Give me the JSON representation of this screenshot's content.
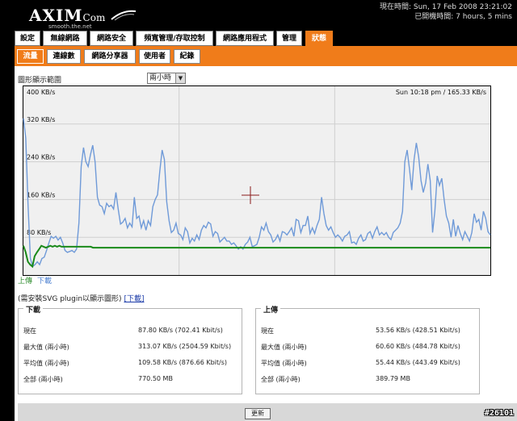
{
  "logo": {
    "brand": "AXIM",
    "brand_suffix": "Com",
    "tagline": "smooth.the.net"
  },
  "system": {
    "time_line": "現在時間: Sun, 17 Feb 2008 23:21:02",
    "uptime_line": "已開機時間: 7 hours, 5 mins"
  },
  "main_tabs": [
    {
      "label": "設定",
      "active": false
    },
    {
      "label": "無線網路",
      "active": false
    },
    {
      "label": "網路安全",
      "active": false
    },
    {
      "label": "頻寬管理/存取控制",
      "active": false
    },
    {
      "label": "網路應用程式",
      "active": false
    },
    {
      "label": "管理",
      "active": false
    },
    {
      "label": "狀態",
      "active": true
    }
  ],
  "sub_tabs": [
    {
      "label": "流量",
      "active": true
    },
    {
      "label": "連線數",
      "active": false
    },
    {
      "label": "網路分享器",
      "active": false
    },
    {
      "label": "使用者",
      "active": false
    },
    {
      "label": "紀錄",
      "active": false
    }
  ],
  "display_label": "圖形顯示範圍",
  "range_select": {
    "value": "兩小時"
  },
  "chart_data": {
    "type": "line",
    "info": "Sun 10:18 pm / 165.33 KB/s",
    "y_ticks": [
      "400 KB/s",
      "320 KB/s",
      "240 KB/s",
      "160 KB/s",
      "80 KB/s"
    ],
    "ylim": [
      0,
      400
    ],
    "grid": true,
    "series": [
      {
        "name": "下載",
        "color": "#6f9ad8",
        "values": [
          332,
          290,
          150,
          35,
          18,
          22,
          28,
          22,
          35,
          38,
          52,
          68,
          82,
          78,
          82,
          74,
          80,
          68,
          52,
          48,
          50,
          52,
          48,
          55,
          110,
          230,
          270,
          240,
          230,
          255,
          275,
          240,
          165,
          148,
          145,
          130,
          152,
          145,
          148,
          140,
          175,
          140,
          108,
          112,
          120,
          100,
          110,
          102,
          165,
          120,
          125,
          100,
          115,
          95,
          115,
          105,
          145,
          160,
          170,
          220,
          265,
          245,
          155,
          115,
          90,
          95,
          110,
          88,
          85,
          75,
          100,
          92,
          68,
          78,
          72,
          85,
          75,
          95,
          105,
          100,
          112,
          108,
          82,
          92,
          88,
          70,
          75,
          80,
          72,
          72,
          65,
          68,
          62,
          55,
          60,
          55,
          65,
          70,
          80,
          60,
          62,
          65,
          80,
          102,
          95,
          110,
          92,
          85,
          70,
          75,
          85,
          72,
          92,
          90,
          85,
          92,
          100,
          82,
          118,
          115,
          90,
          105,
          105,
          125,
          88,
          100,
          88,
          105,
          118,
          165,
          130,
          105,
          95,
          102,
          90,
          80,
          85,
          80,
          72,
          82,
          85,
          92,
          68,
          70,
          65,
          78,
          85,
          72,
          75,
          88,
          92,
          78,
          92,
          102,
          85,
          90,
          85,
          90,
          80,
          75,
          90,
          95,
          100,
          110,
          135,
          240,
          265,
          225,
          180,
          245,
          280,
          250,
          200,
          175,
          195,
          235,
          200,
          90,
          135,
          210,
          190,
          205,
          160,
          125,
          110,
          80,
          118,
          82,
          105,
          88,
          75,
          92,
          82,
          72,
          90,
          130,
          112,
          118,
          95,
          135,
          120,
          92,
          85
        ]
      },
      {
        "name": "上傳",
        "color": "#1a8a1a",
        "values": [
          62,
          48,
          28,
          22,
          18,
          40,
          48,
          55,
          62,
          60,
          58,
          60,
          62,
          60,
          62,
          60,
          62,
          60,
          60,
          60,
          60,
          60,
          60,
          60,
          60,
          60,
          60,
          60,
          60,
          60,
          60,
          58,
          58,
          58,
          58,
          58,
          58,
          58,
          58,
          58,
          58,
          58,
          58,
          58,
          58,
          58,
          58,
          58,
          58,
          58,
          58,
          58,
          58,
          58,
          58,
          58,
          58,
          58,
          58,
          58,
          58,
          58,
          58,
          58,
          58,
          58,
          58,
          58,
          58,
          58,
          58,
          58,
          58,
          58,
          58,
          58,
          58,
          58,
          58,
          58,
          58,
          58,
          58,
          58,
          58,
          58,
          58,
          58,
          58,
          58,
          58,
          58,
          58,
          58,
          58,
          58,
          58,
          58,
          58,
          58,
          58,
          58,
          58,
          58,
          58,
          58,
          58,
          58,
          58,
          58,
          58,
          58,
          58,
          58,
          58,
          58,
          58,
          58,
          58,
          58,
          58,
          58,
          58,
          58,
          58,
          58,
          58,
          58,
          58,
          58,
          58,
          58,
          58,
          58,
          58,
          58,
          58,
          58,
          58,
          58,
          58,
          58,
          58,
          58,
          58,
          58,
          58,
          58,
          58,
          58,
          58,
          58,
          58,
          58,
          58,
          58,
          58,
          58,
          58,
          58,
          58,
          58,
          58,
          58,
          58,
          58,
          58,
          58,
          58,
          58,
          58,
          58,
          58,
          58,
          58,
          58,
          58,
          58,
          58,
          58,
          58,
          58,
          58,
          58,
          58,
          58,
          58,
          58,
          58,
          58,
          58,
          58,
          58,
          58,
          58,
          58,
          58,
          58,
          58,
          58,
          58,
          58,
          58,
          58,
          58,
          58,
          58,
          58,
          58
        ]
      }
    ]
  },
  "legend": {
    "up": "上傳",
    "down": "下載"
  },
  "svg_note": {
    "text": "(需安裝SVG plugin以顯示圖形) ",
    "link": "[下載]"
  },
  "download_box": {
    "title": "下載",
    "rows": [
      {
        "label": "現在",
        "value": "87.80 KB/s (702.41 Kbit/s)"
      },
      {
        "label": "最大值 (兩小時)",
        "value": "313.07 KB/s (2504.59 Kbit/s)"
      },
      {
        "label": "平均值 (兩小時)",
        "value": "109.58 KB/s (876.66 Kbit/s)"
      },
      {
        "label": "全部 (兩小時)",
        "value": "770.50 MB"
      }
    ]
  },
  "upload_box": {
    "title": "上傳",
    "rows": [
      {
        "label": "現在",
        "value": "53.56 KB/s (428.51 Kbit/s)"
      },
      {
        "label": "最大值 (兩小時)",
        "value": "60.60 KB/s (484.78 Kbit/s)"
      },
      {
        "label": "平均值 (兩小時)",
        "value": "55.44 KB/s (443.49 Kbit/s)"
      },
      {
        "label": "全部 (兩小時)",
        "value": "389.79 MB"
      }
    ]
  },
  "refresh_label": "更新",
  "watermark": "#26101"
}
